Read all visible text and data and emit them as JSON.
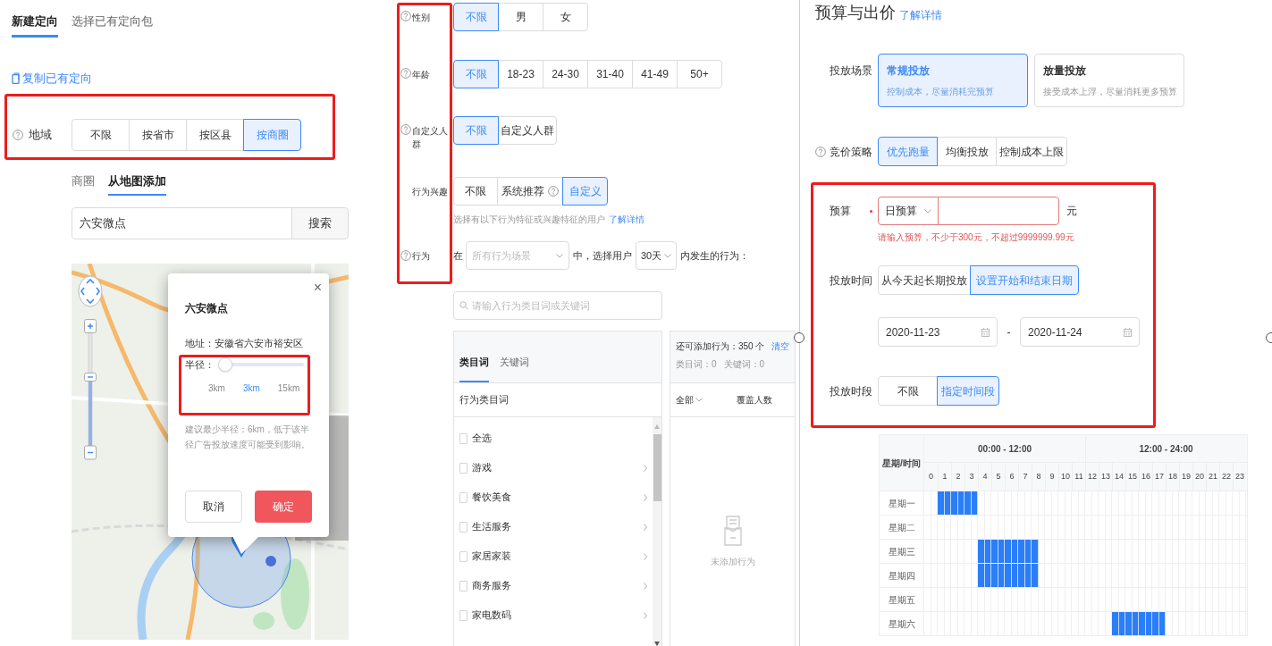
{
  "targeting": {
    "tabs": [
      {
        "label": "新建定向",
        "selected": true
      },
      {
        "label": "选择已有定向包",
        "selected": false
      }
    ],
    "copy_link": "复制已有定向",
    "region": {
      "label": "地域",
      "options": [
        {
          "label": "不限",
          "selected": false
        },
        {
          "label": "按省市",
          "selected": false
        },
        {
          "label": "按区县",
          "selected": false
        },
        {
          "label": "按商圈",
          "selected": true
        }
      ]
    },
    "region_tabs": [
      {
        "label": "商圈",
        "selected": false
      },
      {
        "label": "从地图添加",
        "selected": true
      }
    ],
    "search": {
      "value": "六安微点",
      "button": "搜索"
    },
    "map_popup": {
      "title": "六安微点",
      "close": "×",
      "address": "地址：安徽省六安市裕安区",
      "radius_label": "半径：",
      "level": 0,
      "marks": [
        {
          "label": "3km",
          "selected": false
        },
        {
          "label": "3km",
          "selected": true
        },
        {
          "label": "15km",
          "selected": false
        }
      ],
      "hint": "建议最少半径：6km，低于该半径广告投放速度可能受到影响。",
      "buttons": [
        {
          "label": "取消",
          "kind": "secondary"
        },
        {
          "label": "确定",
          "kind": "primary"
        }
      ]
    }
  },
  "audience": {
    "rows": [
      {
        "label": "性别",
        "help": true,
        "options": [
          {
            "label": "不限",
            "selected": true
          },
          {
            "label": "男",
            "selected": false
          },
          {
            "label": "女",
            "selected": false
          }
        ]
      },
      {
        "label": "年龄",
        "help": true,
        "options": [
          {
            "label": "不限",
            "selected": true
          },
          {
            "label": "18-23",
            "selected": false
          },
          {
            "label": "24-30",
            "selected": false
          },
          {
            "label": "31-40",
            "selected": false
          },
          {
            "label": "41-49",
            "selected": false
          },
          {
            "label": "50+",
            "selected": false
          }
        ]
      },
      {
        "label": "自定义人群",
        "help": true,
        "options": [
          {
            "label": "不限",
            "selected": true
          },
          {
            "label": "自定义人群",
            "selected": false
          }
        ]
      },
      {
        "label": "行为兴趣",
        "help": false,
        "options": [
          {
            "label": "不限",
            "selected": false
          },
          {
            "label": "系统推荐",
            "selected": false,
            "help": true
          },
          {
            "label": "自定义",
            "selected": true
          }
        ]
      }
    ],
    "interest_hint": "选择有以下行为特征或兴趣特征的用户",
    "interest_link": "了解详情",
    "behavior": {
      "label": "行为",
      "prefix": "在",
      "scene_placeholder": "所有行为场景",
      "middle": "中，选择用户",
      "days": "30天",
      "suffix": "内发生的行为："
    },
    "search_placeholder": "请输入行为类目词或关键词",
    "category_panel": {
      "tabs": [
        {
          "label": "类目词",
          "selected": true
        },
        {
          "label": "关键词",
          "selected": false
        }
      ],
      "header": "行为类目词",
      "items": [
        {
          "label": "全选",
          "checked": false,
          "expandable": false
        },
        {
          "label": "游戏",
          "checked": false,
          "expandable": true
        },
        {
          "label": "餐饮美食",
          "checked": false,
          "expandable": true
        },
        {
          "label": "生活服务",
          "checked": false,
          "expandable": true
        },
        {
          "label": "家居家装",
          "checked": false,
          "expandable": true
        },
        {
          "label": "商务服务",
          "checked": false,
          "expandable": true
        },
        {
          "label": "家电数码",
          "checked": false,
          "expandable": true
        }
      ]
    },
    "selected_panel": {
      "remaining": "还可添加行为：350 个",
      "clear": "清空",
      "counts": [
        "类目词：0",
        "关键词：0"
      ],
      "columns": [
        "全部",
        "覆盖人数"
      ],
      "empty": "未添加行为"
    }
  },
  "bidding": {
    "title": "预算与出价",
    "link": "了解详情",
    "scene": {
      "label": "投放场景",
      "options": [
        {
          "title": "常规投放",
          "desc": "控制成本，尽量消耗完预算",
          "selected": true
        },
        {
          "title": "放量投放",
          "desc": "接受成本上浮，尽量消耗更多预算",
          "selected": false
        }
      ]
    },
    "strategy": {
      "label": "竞价策略",
      "options": [
        {
          "label": "优先跑量",
          "selected": true
        },
        {
          "label": "均衡投放",
          "selected": false
        },
        {
          "label": "控制成本上限",
          "selected": false
        }
      ]
    },
    "budget": {
      "label": "预算",
      "required": true,
      "type": "日预算",
      "unit": "元",
      "error": "请输入预算，不少于300元，不超过9999999.99元"
    },
    "time": {
      "label": "投放时间",
      "options": [
        {
          "label": "从今天起长期投放",
          "selected": false
        },
        {
          "label": "设置开始和结束日期",
          "selected": true
        }
      ],
      "start": "2020-11-23",
      "separator": "-",
      "end": "2020-11-24"
    },
    "period": {
      "label": "投放时段",
      "options": [
        {
          "label": "不限",
          "selected": false
        },
        {
          "label": "指定时间段",
          "selected": true
        }
      ]
    },
    "schedule": {
      "corner": "星期/时间",
      "halves": [
        "00:00 - 12:00",
        "12:00 - 24:00"
      ],
      "hours": [
        "0",
        "1",
        "2",
        "3",
        "4",
        "5",
        "6",
        "7",
        "8",
        "9",
        "10",
        "11",
        "12",
        "13",
        "14",
        "15",
        "16",
        "17",
        "18",
        "19",
        "20",
        "21",
        "22",
        "23"
      ],
      "days": [
        {
          "label": "星期一",
          "cells": [
            false,
            false,
            true,
            true,
            true,
            true,
            true,
            true,
            false,
            false,
            false,
            false,
            false,
            false,
            false,
            false,
            false,
            false,
            false,
            false,
            false,
            false,
            false,
            false,
            false,
            false,
            false,
            false,
            false,
            false,
            false,
            false,
            false,
            false,
            false,
            false,
            false,
            false,
            false,
            false,
            false,
            false,
            false,
            false,
            false,
            false,
            false,
            false
          ]
        },
        {
          "label": "星期二",
          "cells": [
            false,
            false,
            false,
            false,
            false,
            false,
            false,
            false,
            false,
            false,
            false,
            false,
            false,
            false,
            false,
            false,
            false,
            false,
            false,
            false,
            false,
            false,
            false,
            false,
            false,
            false,
            false,
            false,
            false,
            false,
            false,
            false,
            false,
            false,
            false,
            false,
            false,
            false,
            false,
            false,
            false,
            false,
            false,
            false,
            false,
            false,
            false,
            false
          ]
        },
        {
          "label": "星期三",
          "cells": [
            false,
            false,
            false,
            false,
            false,
            false,
            false,
            false,
            true,
            true,
            true,
            true,
            true,
            true,
            true,
            true,
            true,
            false,
            false,
            false,
            false,
            false,
            false,
            false,
            false,
            false,
            false,
            false,
            false,
            false,
            false,
            false,
            false,
            false,
            false,
            false,
            false,
            false,
            false,
            false,
            false,
            false,
            false,
            false,
            false,
            false,
            false,
            false
          ]
        },
        {
          "label": "星期四",
          "cells": [
            false,
            false,
            false,
            false,
            false,
            false,
            false,
            false,
            true,
            true,
            true,
            true,
            true,
            true,
            true,
            true,
            true,
            false,
            false,
            false,
            false,
            false,
            false,
            false,
            false,
            false,
            false,
            false,
            false,
            false,
            false,
            false,
            false,
            false,
            false,
            false,
            false,
            false,
            false,
            false,
            false,
            false,
            false,
            false,
            false,
            false,
            false,
            false
          ]
        },
        {
          "label": "星期五",
          "cells": [
            false,
            false,
            false,
            false,
            false,
            false,
            false,
            false,
            false,
            false,
            false,
            false,
            false,
            false,
            false,
            false,
            false,
            false,
            false,
            false,
            false,
            false,
            false,
            false,
            false,
            false,
            false,
            false,
            false,
            false,
            false,
            false,
            false,
            false,
            false,
            false,
            false,
            false,
            false,
            false,
            false,
            false,
            false,
            false,
            false,
            false,
            false,
            false
          ]
        },
        {
          "label": "星期六",
          "cells": [
            false,
            false,
            false,
            false,
            false,
            false,
            false,
            false,
            false,
            false,
            false,
            false,
            false,
            false,
            false,
            false,
            false,
            false,
            false,
            false,
            false,
            false,
            false,
            false,
            false,
            false,
            false,
            false,
            true,
            true,
            true,
            true,
            true,
            true,
            true,
            true,
            false,
            false,
            false,
            false,
            false,
            false,
            false,
            false,
            false,
            false,
            false,
            false
          ]
        }
      ]
    }
  }
}
